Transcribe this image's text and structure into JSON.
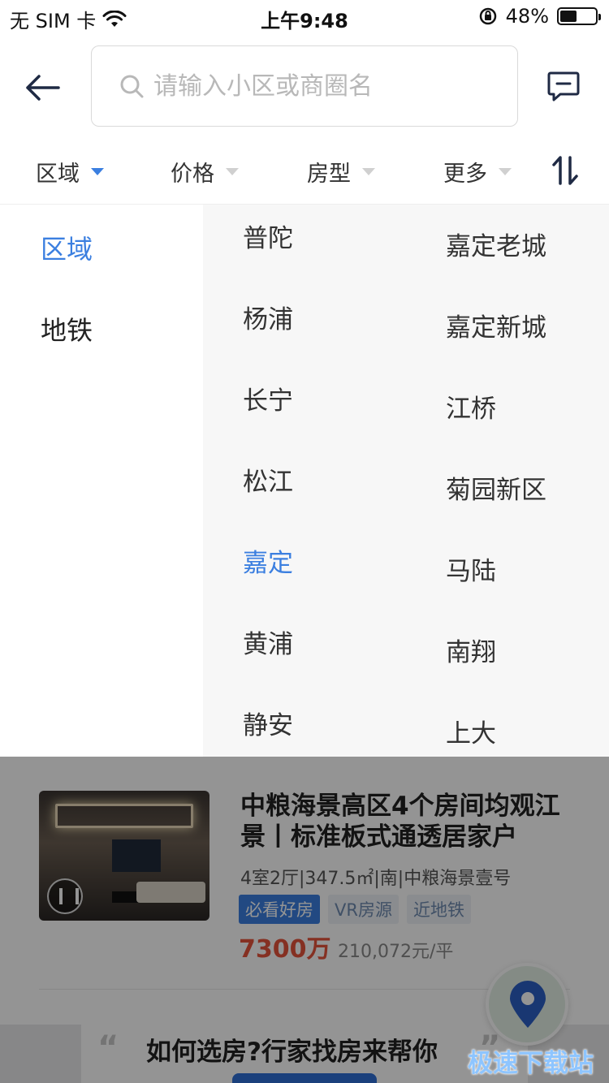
{
  "status_bar": {
    "carrier": "无 SIM 卡",
    "time": "上午9:48",
    "battery": "48%",
    "battery_level": 0.48
  },
  "header": {
    "search_placeholder": "请输入小区或商圈名",
    "search_value": ""
  },
  "filters": {
    "tabs": [
      {
        "label": "区域",
        "active": true
      },
      {
        "label": "价格",
        "active": false
      },
      {
        "label": "房型",
        "active": false
      },
      {
        "label": "更多",
        "active": false
      }
    ]
  },
  "dropdown": {
    "categories": [
      {
        "label": "区域",
        "active": true
      },
      {
        "label": "地铁",
        "active": false
      }
    ],
    "districts": [
      {
        "label": "普陀"
      },
      {
        "label": "杨浦"
      },
      {
        "label": "长宁"
      },
      {
        "label": "松江"
      },
      {
        "label": "嘉定",
        "active": true
      },
      {
        "label": "黄浦"
      },
      {
        "label": "静安"
      }
    ],
    "sub_areas": [
      {
        "label": "嘉定老城"
      },
      {
        "label": "嘉定新城"
      },
      {
        "label": "江桥"
      },
      {
        "label": "菊园新区"
      },
      {
        "label": "马陆"
      },
      {
        "label": "南翔"
      },
      {
        "label": "上大"
      }
    ]
  },
  "listing": {
    "title": "中粮海景高区4个房间均观江景丨标准板式通透居家户",
    "meta": "4室2厅|347.5㎡|南|中粮海景壹号",
    "tags": [
      "必看好房",
      "VR房源",
      "近地铁"
    ],
    "price": "7300万",
    "unit_price": "210,072元/平"
  },
  "banner": {
    "text": "如何选房?行家找房来帮你",
    "quote_open": "“",
    "quote_close": "”"
  },
  "watermark": "极速下载站",
  "colors": {
    "accent": "#3b7fe0",
    "price": "#e5533c",
    "tag_primary": "#3b7fe0"
  }
}
